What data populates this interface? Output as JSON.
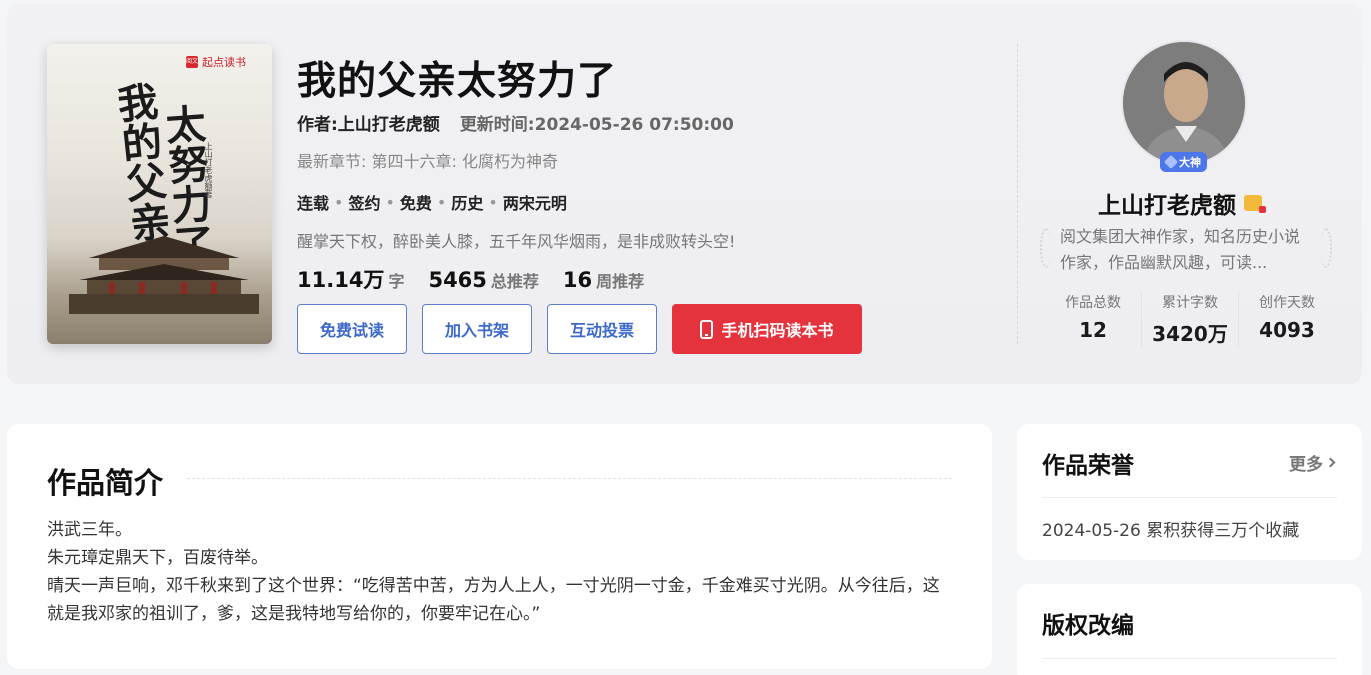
{
  "book": {
    "cover_brand": "起点读书",
    "cover_brand_mark": "阅文",
    "cover_calligraphy_1": "我的父亲",
    "cover_calligraphy_2": "太努力了",
    "cover_author": "上山打老虎额著",
    "title": "我的父亲太努力了",
    "author_label": "作者:上山打老虎额",
    "update_label": "更新时间:2024-05-26 07:50:00",
    "latest_chapter": "最新章节: 第四十六章: 化腐朽为神奇",
    "tags": [
      "连载",
      "签约",
      "免费",
      "历史",
      "两宋元明"
    ],
    "slogan": "醒掌天下权，醉卧美人膝，五千年风华烟雨，是非成败转头空!",
    "stats": [
      {
        "num": "11.14万",
        "unit": "字"
      },
      {
        "num": "5465",
        "unit": "总推荐"
      },
      {
        "num": "16",
        "unit": "周推荐"
      }
    ],
    "buttons": {
      "free_read": "免费试读",
      "add_shelf": "加入书架",
      "vote": "互动投票",
      "scan_read": "手机扫码读本书"
    }
  },
  "author": {
    "badge": "大神",
    "name": "上山打老虎额",
    "desc": "阅文集团大神作家，知名历史小说作家，作品幽默风趣，可读...",
    "stats": [
      {
        "label": "作品总数",
        "value": "12"
      },
      {
        "label": "累计字数",
        "value": "3420万"
      },
      {
        "label": "创作天数",
        "value": "4093"
      }
    ]
  },
  "intro": {
    "title": "作品简介",
    "lines": [
      "洪武三年。",
      "朱元璋定鼎天下，百废待举。",
      "晴天一声巨响，邓千秋来到了这个世界：“吃得苦中苦，方为人上人，一寸光阴一寸金，千金难买寸光阴。从今往后，这就是我邓家的祖训了，爹，这是我特地写给你的，你要牢记在心。”"
    ]
  },
  "honor": {
    "title": "作品荣誉",
    "more": "更多",
    "item": "2024-05-26 累积获得三万个收藏"
  },
  "rights": {
    "title": "版权改编"
  },
  "colors": {
    "accent_blue": "#3d69c8",
    "accent_red": "#e5333d",
    "badge_blue": "#4c76ea"
  }
}
